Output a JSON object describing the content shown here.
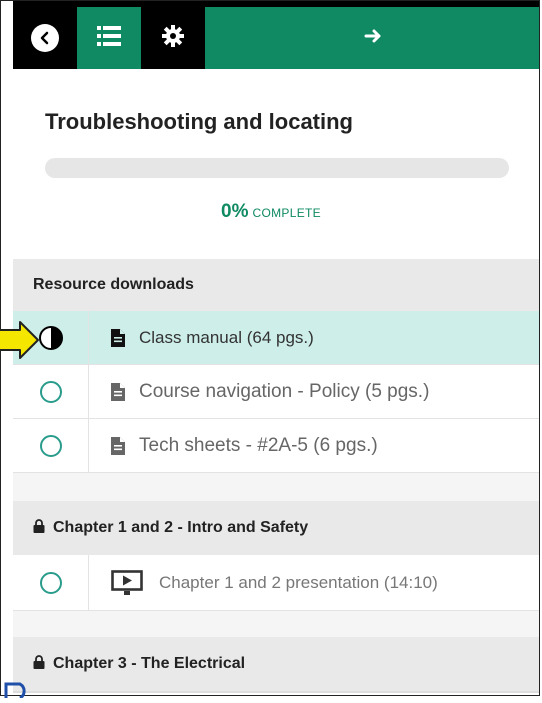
{
  "toolbar": {
    "back_icon": "chevron-left-icon",
    "list_icon": "list-icon",
    "settings_icon": "gear-icon",
    "next_icon": "arrow-right-icon",
    "accent": "#0f8a63"
  },
  "course": {
    "title": "Troubleshooting and locating",
    "progress_percent": "0%",
    "progress_label": "COMPLETE",
    "progress_value": 0
  },
  "sections": [
    {
      "title": "Resource downloads",
      "locked": false,
      "items": [
        {
          "label": "Class manual (64 pgs.)",
          "icon": "document-icon",
          "status": "in-progress"
        },
        {
          "label": "Course navigation - Policy (5 pgs.)",
          "icon": "document-icon",
          "status": "not-started"
        },
        {
          "label": "Tech sheets - #2A-5 (6 pgs.)",
          "icon": "document-icon",
          "status": "not-started"
        }
      ]
    },
    {
      "title": "Chapter 1 and 2 - Intro and Safety",
      "locked": true,
      "items": [
        {
          "label": "Chapter 1 and 2 presentation (14:10)",
          "icon": "video-icon",
          "status": "not-started"
        }
      ]
    },
    {
      "title": "Chapter 3 - The Electrical",
      "locked": true,
      "items": []
    }
  ]
}
